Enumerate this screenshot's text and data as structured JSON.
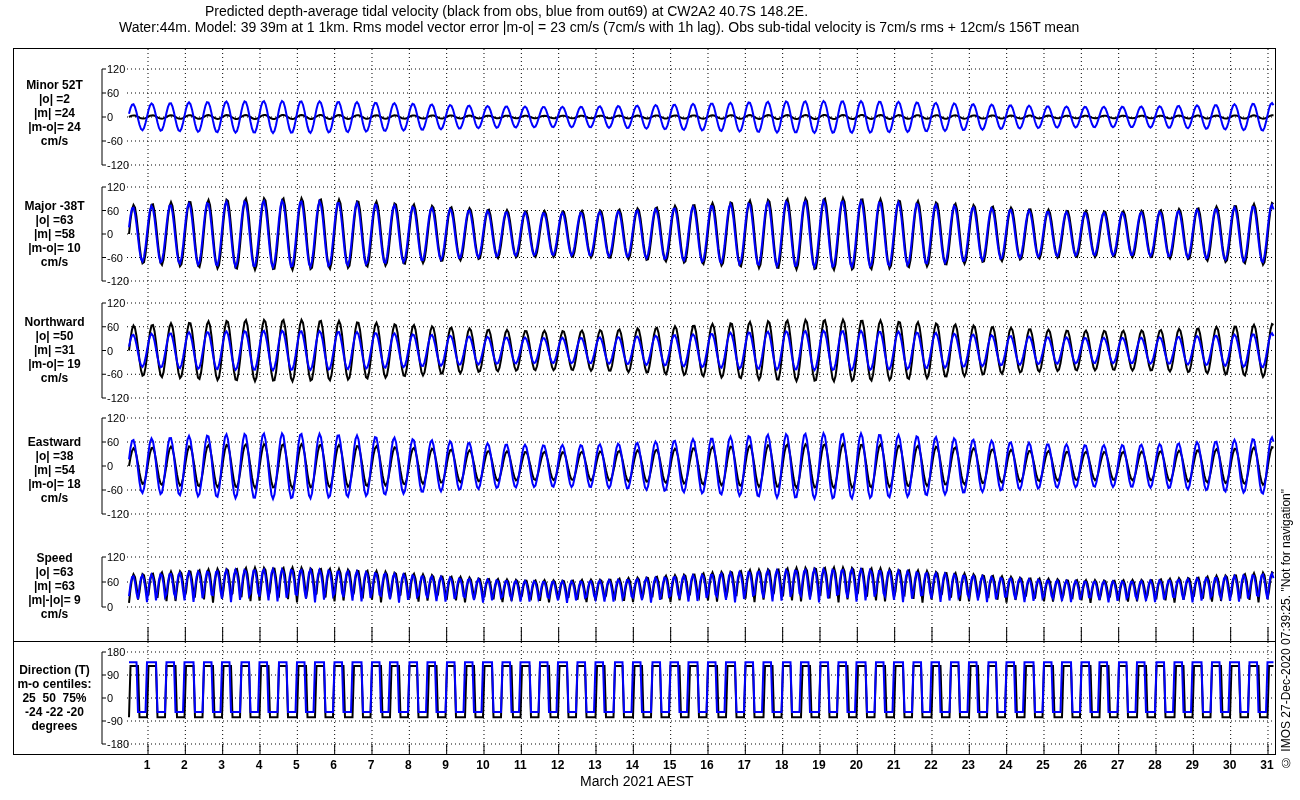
{
  "title": {
    "line_1": "Predicted depth-average tidal velocity (black from obs, blue from out69) at CW2A2 40.7S 148.2E.",
    "line_2": "Water:44m. Model: 39 39m at 1 1km. Rms model vector error |m-o| = 23 cm/s (7cm/s with 1h lag). Obs sub-tidal velocity is 7cm/s rms + 12cm/s 156T mean"
  },
  "panels": [
    {
      "kind": "velocity",
      "label_lines": [
        "Minor 52T",
        "|o| =2",
        "|m| =24",
        "|m-o|= 24",
        "cm/s"
      ],
      "yticks": [
        "120",
        "60",
        "0",
        "-60",
        "-120"
      ]
    },
    {
      "kind": "velocity",
      "label_lines": [
        "Major -38T",
        "|o| =63",
        "|m| =58",
        "|m-o|= 10",
        "cm/s"
      ],
      "yticks": [
        "120",
        "60",
        "0",
        "-60",
        "-120"
      ]
    },
    {
      "kind": "velocity",
      "label_lines": [
        "Northward",
        "|o| =50",
        "|m| =31",
        "|m-o|= 19",
        "cm/s"
      ],
      "yticks": [
        "120",
        "60",
        "0",
        "-60",
        "-120"
      ]
    },
    {
      "kind": "velocity",
      "label_lines": [
        "Eastward",
        "|o| =38",
        "|m| =54",
        "|m-o|= 18",
        "cm/s"
      ],
      "yticks": [
        "120",
        "60",
        "0",
        "-60",
        "-120"
      ]
    },
    {
      "kind": "speed",
      "label_lines": [
        "Speed",
        "|o| =63",
        "|m| =63",
        "|m|-|o|= 9",
        "cm/s"
      ],
      "yticks": [
        "120",
        "60",
        "0"
      ]
    },
    {
      "kind": "direction",
      "label_lines": [
        "Direction (T)",
        "m-o centiles:",
        "25  50  75%",
        "-24 -22 -20",
        "degrees"
      ],
      "yticks": [
        "180",
        "90",
        "0",
        "-90",
        "-180"
      ]
    }
  ],
  "xaxis": {
    "ticks": [
      "1",
      "2",
      "3",
      "4",
      "5",
      "6",
      "7",
      "8",
      "9",
      "10",
      "11",
      "12",
      "13",
      "14",
      "15",
      "16",
      "17",
      "18",
      "19",
      "20",
      "21",
      "22",
      "23",
      "24",
      "25",
      "26",
      "27",
      "28",
      "29",
      "30",
      "31"
    ],
    "label": "March 2021 AEST"
  },
  "footer": "© IMOS 27-Dec-2020 07:39:25.  \"Not for navigation\""
}
